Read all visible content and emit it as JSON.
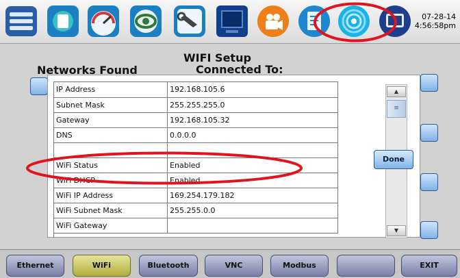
{
  "toolbar": {
    "icons": [
      "app-menu-icon",
      "square-icon",
      "gauge-icon",
      "eye-icon",
      "wrench-icon",
      "monitor-icon",
      "camera-icon",
      "document-icon",
      "wifi-icon",
      "display-icon"
    ],
    "date": "07-28-14",
    "time": "4:56:58pm"
  },
  "main": {
    "title": "WIFI Setup",
    "connected_label": "Connected To:",
    "networks_label": "Networks Found"
  },
  "dialog": {
    "rows": [
      {
        "key": "IP Address",
        "value": "192.168.105.6"
      },
      {
        "key": "Subnet Mask",
        "value": "255.255.255.0"
      },
      {
        "key": "Gateway",
        "value": "192.168.105.32"
      },
      {
        "key": "DNS",
        "value": "0.0.0.0"
      },
      {
        "key": "",
        "value": ""
      },
      {
        "key": "WiFi Status",
        "value": "Enabled"
      },
      {
        "key": "WiFi DHCP",
        "value": "Enabled"
      },
      {
        "key": "WiFi IP Address",
        "value": "169.254.179.182"
      },
      {
        "key": "WiFi Subnet Mask",
        "value": "255.255.0.0"
      },
      {
        "key": "WiFi Gateway",
        "value": ""
      }
    ],
    "done_label": "Done"
  },
  "tabs": [
    "Ethernet",
    "WiFi",
    "Bluetooth",
    "VNC",
    "Modbus",
    "",
    "EXIT"
  ],
  "colors": {
    "annotation": "#e0141e",
    "accent": "#2f6fb3",
    "active_tab": "#c9c35a"
  }
}
